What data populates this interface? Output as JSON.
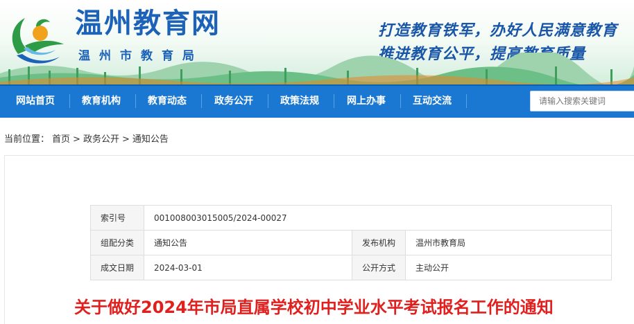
{
  "header": {
    "site_title": "温州教育网",
    "site_subtitle": "温州市教育局",
    "slogan_line1": "打造教育铁军，办好人民满意教育",
    "slogan_line2": "推进教育公平，提高教育质量"
  },
  "nav": {
    "items": [
      {
        "label": "网站首页"
      },
      {
        "label": "教育机构"
      },
      {
        "label": "教育动态"
      },
      {
        "label": "政务公开"
      },
      {
        "label": "政策法规"
      },
      {
        "label": "网上办事"
      },
      {
        "label": "互动交流"
      }
    ],
    "search_placeholder": "请输入搜索关键词"
  },
  "breadcrumb": {
    "prefix": "当前位置：",
    "home": "首页",
    "sep": ">",
    "level1": "政务公开",
    "level2": "通知公告"
  },
  "meta": {
    "index_label": "索引号",
    "index_value": "001008003015005/2024-00027",
    "category_label": "组配分类",
    "category_value": "通知公告",
    "publisher_label": "发布机构",
    "publisher_value": "温州市教育局",
    "date_label": "成文日期",
    "date_value": "2024-03-01",
    "disclosure_label": "公开方式",
    "disclosure_value": "主动公开"
  },
  "article": {
    "title": "关于做好2024年市局直属学校初中学业水平考试报名工作的通知"
  },
  "colors": {
    "nav_bg": "#1a78d2",
    "brand_blue": "#1b62b8",
    "title_red": "#e0201e"
  }
}
